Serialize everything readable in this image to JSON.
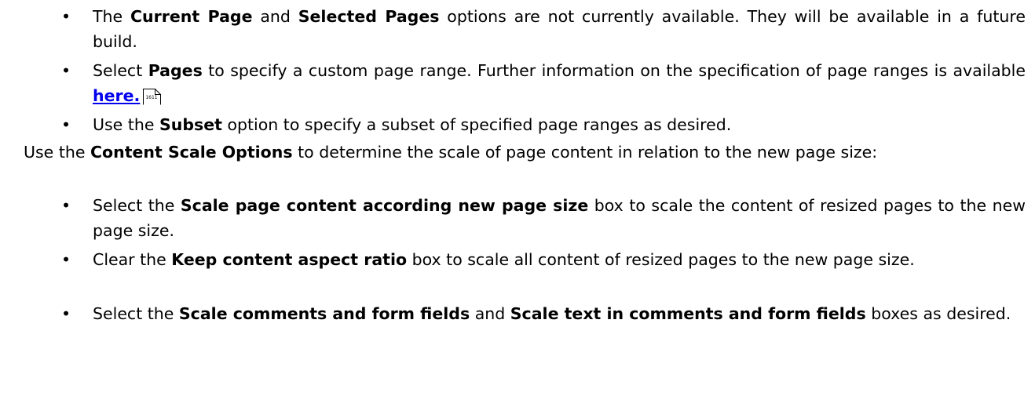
{
  "bullet_glyph": "•",
  "items": [
    {
      "id": "current-page",
      "parts": [
        {
          "t": "The "
        },
        {
          "b": "Current Page"
        },
        {
          "t": " and "
        },
        {
          "b": "Selected Pages"
        },
        {
          "t": " options are not currently available. They will be available in a future build."
        }
      ]
    },
    {
      "id": "pages",
      "parts": [
        {
          "t": "Select "
        },
        {
          "b": "Pages"
        },
        {
          "t": " to specify a custom page range. Further information on the specification of page ranges is available "
        }
      ],
      "link_text": "here.",
      "page_ref": "1611"
    },
    {
      "id": "subset",
      "parts": [
        {
          "t": "Use the "
        },
        {
          "b": "Subset"
        },
        {
          "t": " option to specify a subset of specified page ranges as desired."
        }
      ]
    },
    {
      "id": "content-scale",
      "parts": [
        {
          "t": "Use the "
        },
        {
          "b": "Content Scale Options"
        },
        {
          "t": " to determine the scale of page content in relation to the new page size:"
        }
      ]
    },
    {
      "id": "scale-page-content",
      "parts": [
        {
          "t": "Select the "
        },
        {
          "b": "Scale page content according new page size"
        },
        {
          "t": " box to scale the content of resized pages to the new page size."
        }
      ]
    },
    {
      "id": "keep-aspect",
      "parts": [
        {
          "t": "Clear the "
        },
        {
          "b": "Keep content aspect ratio"
        },
        {
          "t": " box to scale all content of resized pages to the new page size."
        }
      ]
    },
    {
      "id": "scale-comments",
      "parts": [
        {
          "t": "Select the "
        },
        {
          "b": "Scale comments and form fields"
        },
        {
          "t": " and "
        },
        {
          "b": "Scale text in comments and form fields"
        },
        {
          "t": " boxes as desired."
        }
      ]
    }
  ]
}
